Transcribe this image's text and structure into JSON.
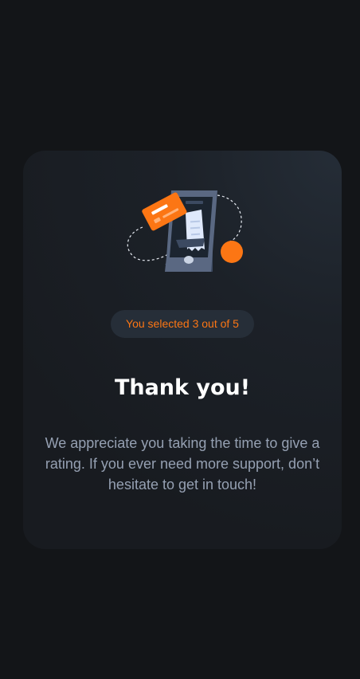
{
  "thank_you": {
    "selection_text": "You selected 3 out of 5",
    "title": "Thank you!",
    "message": "We appreciate you taking the time to give a rating. If you ever need more support, don’t hesitate to get in touch!",
    "rating_selected": 3,
    "rating_max": 5
  },
  "illustration": {
    "icon": "payment-phone-illustration",
    "colors": {
      "accent": "#fc7614",
      "phone": "#5a6882",
      "phone_dark": "#3c4a61",
      "receipt": "#dfe9fb"
    }
  },
  "colors": {
    "background": "#131518",
    "card": "#1e2329",
    "badge_bg": "#262e38",
    "accent": "#fc7614",
    "title": "#ffffff",
    "body_text": "#95a0b2"
  }
}
